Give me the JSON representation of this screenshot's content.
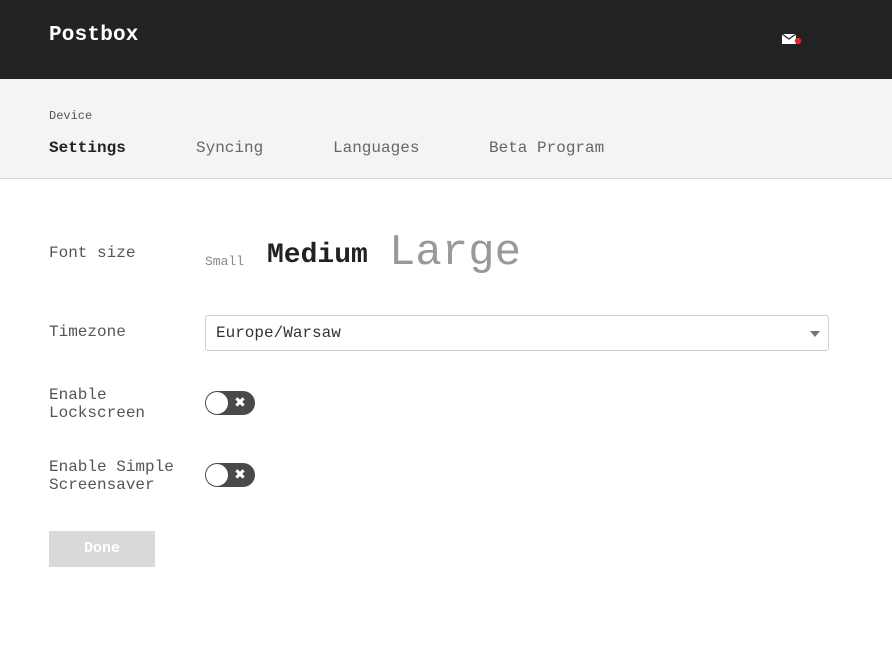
{
  "header": {
    "app_title": "Postbox",
    "icons": {
      "mail": "mail-notification-icon"
    },
    "colors": {
      "bar": "#222222",
      "notification_dot": "#e0282b"
    }
  },
  "subheader": {
    "breadcrumb": "Device",
    "tabs": [
      {
        "label": "Settings",
        "active": true
      },
      {
        "label": "Syncing",
        "active": false
      },
      {
        "label": "Languages",
        "active": false
      },
      {
        "label": "Beta Program",
        "active": false
      }
    ]
  },
  "settings": {
    "font_size": {
      "label": "Font size",
      "options": [
        "Small",
        "Medium",
        "Large"
      ],
      "selected": "Medium"
    },
    "timezone": {
      "label": "Timezone",
      "value": "Europe/Warsaw"
    },
    "lockscreen": {
      "label": "Enable Lockscreen",
      "enabled": false,
      "toggle_glyph": "✖"
    },
    "screensaver": {
      "label": "Enable Simple Screensaver",
      "enabled": false,
      "toggle_glyph": "✖"
    }
  },
  "actions": {
    "done_label": "Done"
  }
}
